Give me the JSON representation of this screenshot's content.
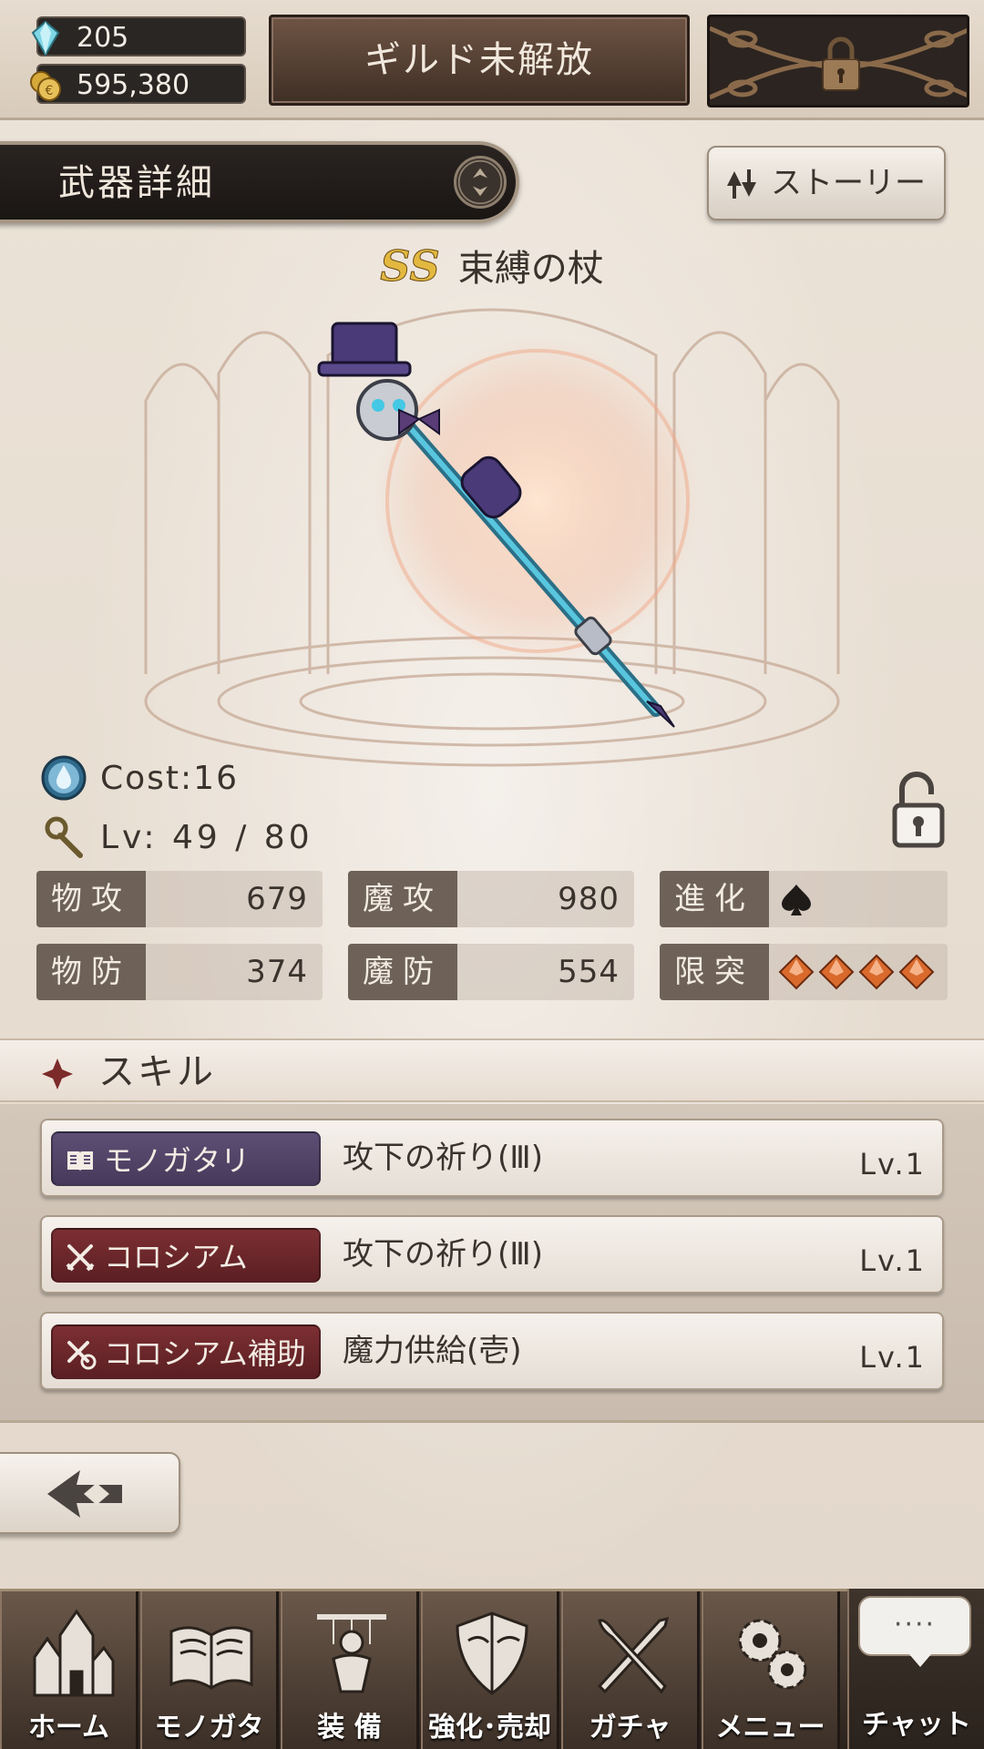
{
  "resources": {
    "gems": "205",
    "coins": "595,380"
  },
  "header": {
    "guild_label": "ギルド未解放",
    "page_title": "武器詳細",
    "story_label": "ストーリー"
  },
  "weapon": {
    "rank": "SS",
    "name": "束縛の杖",
    "cost": "Cost:16",
    "level": "Lv: 49 / 80"
  },
  "stats": {
    "p_atk_label": "物攻",
    "p_atk": "679",
    "m_atk_label": "魔攻",
    "m_atk": "980",
    "evo_label": "進化",
    "evo_icon": "spade-icon",
    "p_def_label": "物防",
    "p_def": "374",
    "m_def_label": "魔防",
    "m_def": "554",
    "limit_label": "限突",
    "limit_count": 4
  },
  "skills": {
    "title": "スキル",
    "items": [
      {
        "category": "モノガタリ",
        "name": "攻下の祈り(Ⅲ)",
        "level": "Lv.1",
        "icon": "book-icon",
        "color": "#5d4f74"
      },
      {
        "category": "コロシアム",
        "name": "攻下の祈り(Ⅲ)",
        "level": "Lv.1",
        "icon": "crossed-swords-icon",
        "color": "#7c2f33"
      },
      {
        "category": "コロシアム補助",
        "name": "魔力供給(壱)",
        "level": "Lv.1",
        "icon": "crossed-swords-circle-icon",
        "color": "#7c2f33"
      }
    ]
  },
  "nav": {
    "items": [
      {
        "label": "ホーム",
        "icon": "castle-icon"
      },
      {
        "label": "モノガタリ",
        "icon": "open-book-icon"
      },
      {
        "label": "装 備",
        "icon": "puppet-icon"
      },
      {
        "label": "強化･売却",
        "icon": "shield-icon"
      },
      {
        "label": "ガチャ",
        "icon": "sword-quill-icon"
      },
      {
        "label": "メニュー",
        "icon": "gears-icon"
      }
    ],
    "chat_label": "チャット",
    "chat_dots": "····"
  },
  "colors": {
    "accent_gold": "#e2b840",
    "story_purple": "#5d4f74",
    "colosseum_red": "#7c2f33",
    "nav_brown": "#3a2e26"
  }
}
